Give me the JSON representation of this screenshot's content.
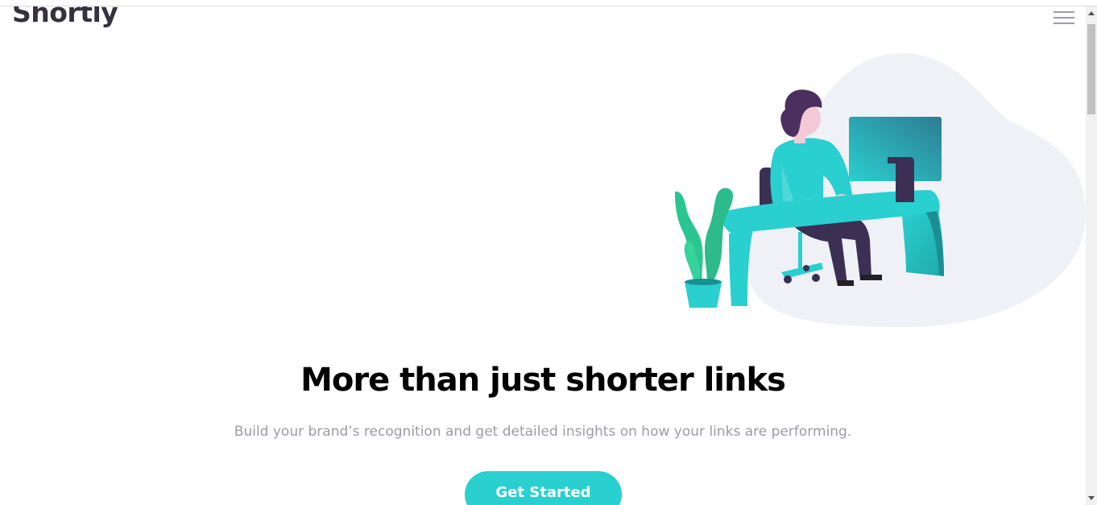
{
  "header": {
    "logo": "Shortly",
    "menu_icon": "hamburger-menu-icon"
  },
  "hero": {
    "illustration": "person-working-illustration",
    "title": "More than just shorter links",
    "subtitle": "Build your brand’s recognition and get detailed insights on how your links are performing.",
    "cta_label": "Get Started"
  },
  "colors": {
    "brand_cyan": "#2acfcf",
    "dark_violet": "#3b3054",
    "grayish_violet": "#9e9aa7",
    "very_dark_blue": "#35323e",
    "blob": "#f0f1f6"
  }
}
